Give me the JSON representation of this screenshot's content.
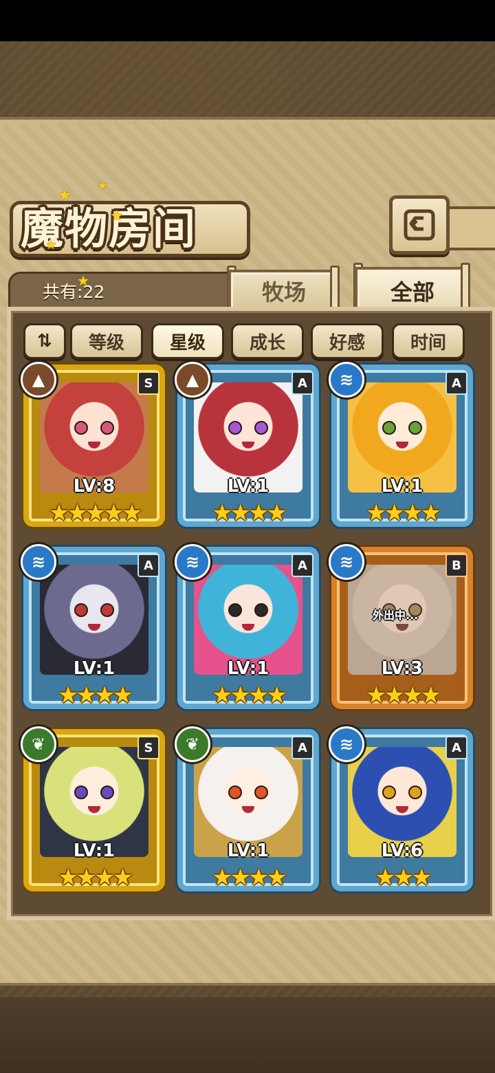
{
  "header": {
    "title": "魔物房间",
    "count_label": "共有:22"
  },
  "tabs": {
    "ranch": "牧场",
    "all": "全部"
  },
  "sort": {
    "toggle": "⇅",
    "options": [
      "等级",
      "星级",
      "成长",
      "好感",
      "时间"
    ],
    "selected": "星级"
  },
  "monsters": [
    {
      "rank": "S",
      "level": "LV:8",
      "stars": "★★★★★",
      "element": "earth-icon"
    },
    {
      "rank": "A",
      "level": "LV:1",
      "stars": "★★★★",
      "element": "earth-icon"
    },
    {
      "rank": "A",
      "level": "LV:1",
      "stars": "★★★★",
      "element": "water-icon"
    },
    {
      "rank": "A",
      "level": "LV:1",
      "stars": "★★★★",
      "element": "water-icon"
    },
    {
      "rank": "A",
      "level": "LV:1",
      "stars": "★★★★",
      "element": "water-icon"
    },
    {
      "rank": "B",
      "level": "LV:3",
      "stars": "★★★★",
      "element": "water-icon",
      "status": "外出中..."
    },
    {
      "rank": "S",
      "level": "LV:1",
      "stars": "★★★★",
      "element": "wood-icon"
    },
    {
      "rank": "A",
      "level": "LV:1",
      "stars": "★★★★",
      "element": "wood-icon"
    },
    {
      "rank": "A",
      "level": "LV:6",
      "stars": "★★★",
      "element": "water-icon"
    }
  ]
}
